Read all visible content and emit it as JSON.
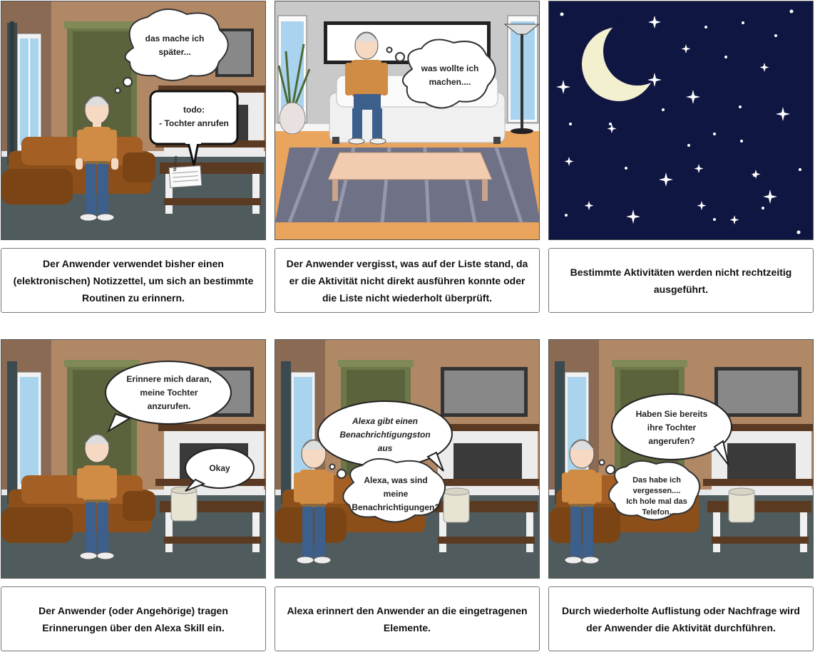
{
  "panels": [
    {
      "bubbles": [
        "das mache ich\nspäter...",
        "todo:\n- Tochter anrufen"
      ],
      "caption": "Der Anwender verwendet bisher einen (elektronischen) Notizzettel, um sich an bestimmte Routinen zu erinnern.",
      "prop_label": "Notizen"
    },
    {
      "bubbles": [
        "was wollte ich\nmachen...."
      ],
      "caption": "Der Anwender vergisst, was auf der Liste stand, da er die Aktivität nicht direkt ausführen konnte oder die Liste nicht wiederholt überprüft."
    },
    {
      "bubbles": [],
      "caption": "Bestimmte Aktivitäten werden nicht rechtzeitig ausgeführt."
    },
    {
      "bubbles": [
        "Erinnere mich daran,\nmeine Tochter\nanzurufen.",
        "Okay"
      ],
      "caption": "Der Anwender (oder Angehörige) tragen Erinnerungen über den Alexa Skill ein."
    },
    {
      "bubbles": [
        "Alexa gibt einen\nBenachrichtigungston\naus",
        "Alexa, was sind\nmeine\nBenachrichtigungen?"
      ],
      "caption": "Alexa erinnert den Anwender an die eingetragenen Elemente."
    },
    {
      "bubbles": [
        "Haben Sie bereits\nihre Tochter\nangerufen?",
        "Das habe ich\nvergessen....\nIch hole mal das\nTelefon."
      ],
      "caption": "Durch wiederholte Auflistung oder Nachfrage wird der Anwender die Aktivität durchführen."
    }
  ],
  "colors": {
    "wall": "#b08866",
    "floor": "#4f5b5c",
    "sofa": "#8c4f1a",
    "shirt": "#d08b45",
    "pants": "#3d5f8c",
    "night": "#101642",
    "moon": "#f3f0d0"
  }
}
